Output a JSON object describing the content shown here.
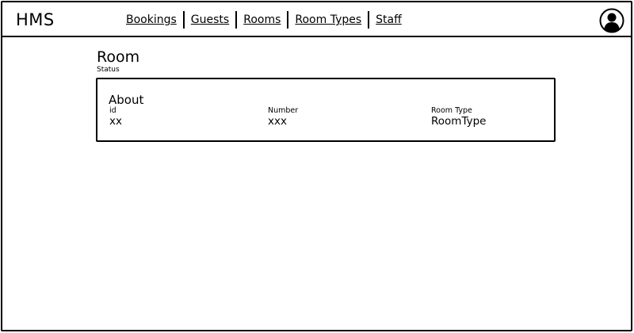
{
  "app": {
    "brand": "HMS"
  },
  "nav": {
    "items": [
      {
        "label": "Bookings"
      },
      {
        "label": "Guests"
      },
      {
        "label": "Rooms"
      },
      {
        "label": "Room Types"
      },
      {
        "label": "Staff"
      }
    ]
  },
  "user": {
    "avatar_icon": "user-avatar-icon"
  },
  "page": {
    "title": "Room",
    "status_label": "Status"
  },
  "about": {
    "title": "About",
    "fields": [
      {
        "label": "id",
        "value": "xx"
      },
      {
        "label": "Number",
        "value": "xxx"
      },
      {
        "label": "Room Type",
        "value": "RoomType"
      }
    ]
  }
}
